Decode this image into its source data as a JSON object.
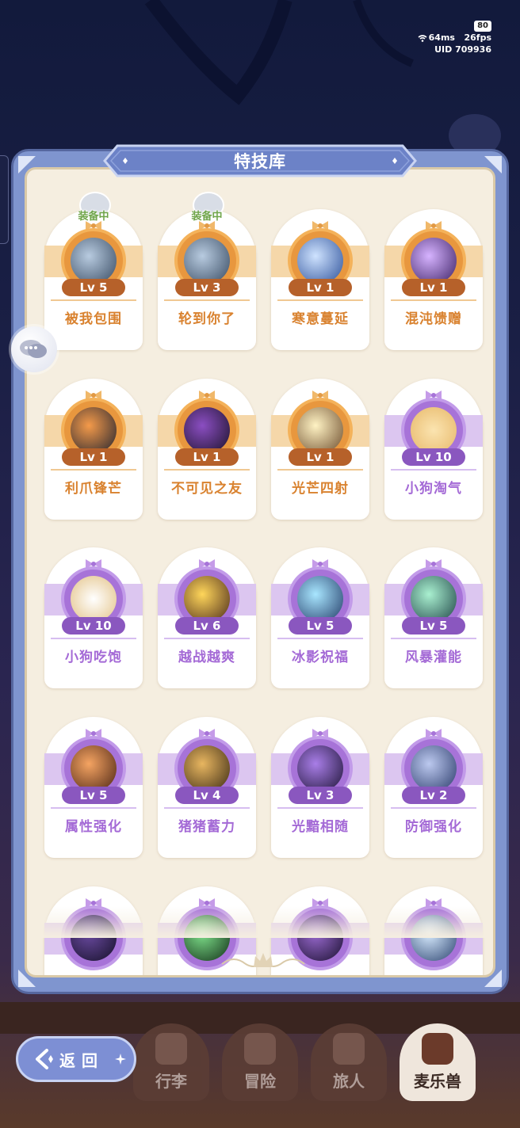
{
  "status": {
    "battery": "80",
    "ping": "64ms",
    "fps": "26fps",
    "uid": "UID 709936"
  },
  "panel": {
    "title": "特技库"
  },
  "equipped_label": "装备中",
  "skills": [
    {
      "name": "被我包围",
      "level": "Lv 5",
      "tier": "orange",
      "equipped": true,
      "icon": "wolf-icon"
    },
    {
      "name": "轮到你了",
      "level": "Lv 3",
      "tier": "orange",
      "equipped": true,
      "icon": "wolf-icon"
    },
    {
      "name": "寒意蔓延",
      "level": "Lv 1",
      "tier": "orange",
      "equipped": false,
      "icon": "ice-wolf-icon"
    },
    {
      "name": "混沌馈赠",
      "level": "Lv 1",
      "tier": "orange",
      "equipped": false,
      "icon": "purple-cat-icon"
    },
    {
      "name": "利爪锋芒",
      "level": "Lv 1",
      "tier": "orange",
      "equipped": false,
      "icon": "dark-fox-icon"
    },
    {
      "name": "不可见之友",
      "level": "Lv 1",
      "tier": "orange",
      "equipped": false,
      "icon": "shadow-bird-icon"
    },
    {
      "name": "光芒四射",
      "level": "Lv 1",
      "tier": "orange",
      "equipped": false,
      "icon": "light-creature-icon"
    },
    {
      "name": "小狗淘气",
      "level": "Lv 10",
      "tier": "purple",
      "equipped": false,
      "icon": "puppy-face-icon"
    },
    {
      "name": "小狗吃饱",
      "level": "Lv 10",
      "tier": "purple",
      "equipped": false,
      "icon": "white-puppy-icon"
    },
    {
      "name": "越战越爽",
      "level": "Lv 6",
      "tier": "purple",
      "equipped": false,
      "icon": "fire-blob-icon"
    },
    {
      "name": "冰影祝福",
      "level": "Lv 5",
      "tier": "purple",
      "equipped": false,
      "icon": "ice-spirit-icon"
    },
    {
      "name": "风暴灌能",
      "level": "Lv 5",
      "tier": "purple",
      "equipped": false,
      "icon": "storm-beast-icon"
    },
    {
      "name": "属性强化",
      "level": "Lv 5",
      "tier": "purple",
      "equipped": false,
      "icon": "fire-cat-icon"
    },
    {
      "name": "猪猪蓄力",
      "level": "Lv 4",
      "tier": "purple",
      "equipped": false,
      "icon": "pig-icon"
    },
    {
      "name": "光黯相随",
      "level": "Lv 3",
      "tier": "purple",
      "equipped": false,
      "icon": "shadow-blob-icon"
    },
    {
      "name": "防御强化",
      "level": "Lv 2",
      "tier": "purple",
      "equipped": false,
      "icon": "armor-whale-icon"
    },
    {
      "name": "",
      "level": "",
      "tier": "purple",
      "equipped": false,
      "icon": "dark-beast-icon"
    },
    {
      "name": "",
      "level": "",
      "tier": "purple",
      "equipped": false,
      "icon": "green-spirit-icon"
    },
    {
      "name": "",
      "level": "",
      "tier": "purple",
      "equipped": false,
      "icon": "shadow-cat-icon"
    },
    {
      "name": "",
      "level": "",
      "tier": "purple",
      "equipped": false,
      "icon": "crystal-icon"
    }
  ],
  "nav": {
    "back": "返回",
    "tabs": [
      "行李",
      "冒险",
      "旅人",
      "麦乐兽"
    ],
    "active_tab": "麦乐兽"
  },
  "colors": {
    "orange_tier": "#e8973e",
    "purple_tier": "#a773d8",
    "panel_blue": "#7f95cf",
    "panel_bg": "#f5eee0"
  }
}
